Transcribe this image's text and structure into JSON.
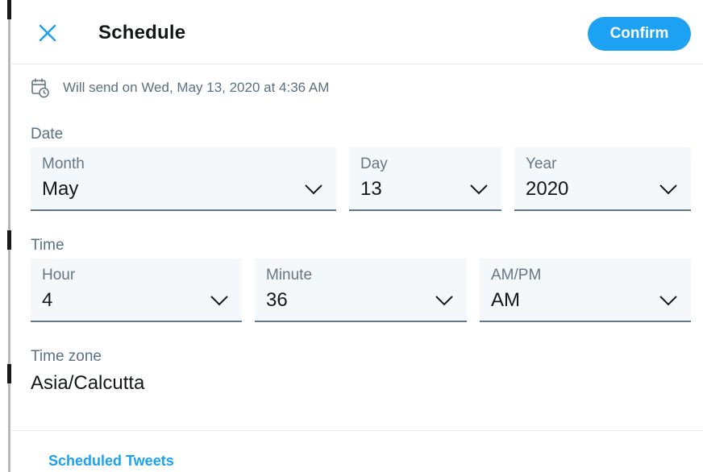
{
  "header": {
    "title": "Schedule",
    "confirm_label": "Confirm"
  },
  "schedule_note": "Will send on Wed, May 13, 2020 at 4:36 AM",
  "date": {
    "label": "Date",
    "month": {
      "label": "Month",
      "value": "May"
    },
    "day": {
      "label": "Day",
      "value": "13"
    },
    "year": {
      "label": "Year",
      "value": "2020"
    }
  },
  "time": {
    "label": "Time",
    "hour": {
      "label": "Hour",
      "value": "4"
    },
    "minute": {
      "label": "Minute",
      "value": "36"
    },
    "ampm": {
      "label": "AM/PM",
      "value": "AM"
    }
  },
  "timezone": {
    "label": "Time zone",
    "value": "Asia/Calcutta"
  },
  "footer": {
    "scheduled_link": "Scheduled Tweets"
  },
  "icons": {
    "close": "close-icon",
    "calendar": "calendar-clock-icon",
    "chevron": "chevron-down-icon"
  },
  "colors": {
    "accent": "#1da1f2",
    "text_primary": "#14171a",
    "text_secondary": "#5b7083",
    "field_background": "#f5f8fa",
    "field_underline": "#657786"
  }
}
